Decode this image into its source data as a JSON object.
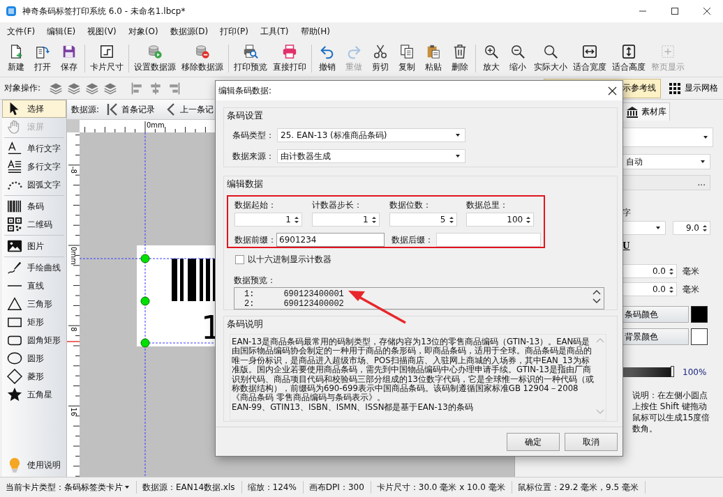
{
  "window": {
    "title": "神奇条码标签打印系统 6.0 - 未命名1.lbcp*"
  },
  "menu": [
    "文件(F)",
    "编辑(E)",
    "视图(V)",
    "对象(O)",
    "数据源(D)",
    "打印(P)",
    "工具(T)",
    "帮助(H)"
  ],
  "toolbar_groups": [
    {
      "buttons": [
        {
          "kind": "new",
          "label": "新建",
          "disabled": false
        },
        {
          "kind": "open",
          "label": "打开",
          "disabled": false
        },
        {
          "kind": "save",
          "label": "保存",
          "disabled": false
        }
      ]
    },
    {
      "buttons": [
        {
          "kind": "card_size",
          "label": "卡片尺寸",
          "disabled": false
        }
      ]
    },
    {
      "buttons": [
        {
          "kind": "set_source",
          "label": "设置数据源",
          "disabled": false
        },
        {
          "kind": "remove_source",
          "label": "移除数据源",
          "disabled": false
        }
      ]
    },
    {
      "buttons": [
        {
          "kind": "print_preview",
          "label": "打印预览",
          "disabled": false
        },
        {
          "kind": "print",
          "label": "直接打印",
          "disabled": false
        }
      ]
    },
    {
      "buttons": [
        {
          "kind": "undo",
          "label": "撤销",
          "disabled": false
        },
        {
          "kind": "redo",
          "label": "重做",
          "disabled": true
        },
        {
          "kind": "cut",
          "label": "剪切",
          "disabled": false
        },
        {
          "kind": "copy",
          "label": "复制",
          "disabled": false
        },
        {
          "kind": "paste",
          "label": "粘贴",
          "disabled": false
        },
        {
          "kind": "delete",
          "label": "删除",
          "disabled": false
        }
      ]
    },
    {
      "buttons": [
        {
          "kind": "zoom_in",
          "label": "放大",
          "disabled": false
        },
        {
          "kind": "zoom_out",
          "label": "缩小",
          "disabled": false
        },
        {
          "kind": "actual_size",
          "label": "实际大小",
          "disabled": false
        },
        {
          "kind": "fit_width",
          "label": "适合宽度",
          "disabled": false
        },
        {
          "kind": "fit_height",
          "label": "适合高度",
          "disabled": false
        },
        {
          "kind": "fit_page",
          "label": "整页显示",
          "disabled": true
        }
      ]
    }
  ],
  "object_bar": {
    "label": "对象操作:",
    "reference_lines": {
      "label": "示参考线",
      "on": true
    },
    "grid": {
      "label": "显示网格",
      "on": false
    }
  },
  "tool_groups": [
    {
      "tools": [
        {
          "kind": "select",
          "label": "选择",
          "selected": true,
          "disabled": false
        },
        {
          "kind": "pan",
          "label": "滚屏",
          "selected": false,
          "disabled": true
        }
      ]
    },
    {
      "tools": [
        {
          "kind": "text_line",
          "label": "单行文字",
          "selected": false,
          "disabled": false
        },
        {
          "kind": "text_multi",
          "label": "多行文字",
          "selected": false,
          "disabled": false
        },
        {
          "kind": "text_arc",
          "label": "圆弧文字",
          "selected": false,
          "disabled": false
        }
      ]
    },
    {
      "tools": [
        {
          "kind": "barcode",
          "label": "条码",
          "selected": false,
          "disabled": false
        },
        {
          "kind": "qrcode",
          "label": "二维码",
          "selected": false,
          "disabled": false
        }
      ]
    },
    {
      "tools": [
        {
          "kind": "picture",
          "label": "图片",
          "selected": false,
          "disabled": false
        }
      ]
    },
    {
      "tools": [
        {
          "kind": "pen",
          "label": "手绘曲线",
          "selected": false,
          "disabled": false
        },
        {
          "kind": "line",
          "label": "直线",
          "selected": false,
          "disabled": false
        },
        {
          "kind": "triangle",
          "label": "三角形",
          "selected": false,
          "disabled": false
        },
        {
          "kind": "rectangle",
          "label": "矩形",
          "selected": false,
          "disabled": false
        },
        {
          "kind": "rounded_rectangle",
          "label": "圆角矩形",
          "selected": false,
          "disabled": false
        },
        {
          "kind": "ellipse",
          "label": "圆形",
          "selected": false,
          "disabled": false
        },
        {
          "kind": "diamond",
          "label": "菱形",
          "selected": false,
          "disabled": false
        },
        {
          "kind": "star",
          "label": "五角星",
          "selected": false,
          "disabled": false
        }
      ]
    }
  ],
  "help": {
    "label": "使用说明"
  },
  "record_nav": {
    "label": "数据源:",
    "buttons": [
      {
        "kind": "first",
        "label": "首条记录"
      },
      {
        "kind": "previous",
        "label": "上一条记"
      }
    ]
  },
  "canvas": {
    "top_ruler": [
      "0mm"
    ],
    "left_ruler": [
      "-8",
      "0mm",
      "8",
      "16"
    ],
    "label_digit": "1"
  },
  "dialog": {
    "title": "编辑条码数据:",
    "barcode_settings": {
      "title": "条码设置",
      "fields": [
        {
          "label": "条码类型：",
          "value": "25. EAN-13 (标准商品条码)"
        },
        {
          "label": "数据来源：",
          "value": "由计数器生成"
        }
      ]
    },
    "edit_data": {
      "title": "编辑数据",
      "counters": [
        {
          "label": "数据起始：",
          "value": "1"
        },
        {
          "label": "计数器步长：",
          "value": "1"
        },
        {
          "label": "数据位数：",
          "value": "5"
        },
        {
          "label": "数据总里：",
          "value": "100"
        }
      ],
      "prefix": {
        "label": "数据前缀：",
        "value": "6901234"
      },
      "suffix": {
        "label": "数据后缀："
      },
      "hex": {
        "label": "以十六进制显示计数器",
        "checked": false
      },
      "preview": {
        "label": "数据预览：",
        "rows": [
          {
            "index": "1:",
            "value": "690123400001"
          },
          {
            "index": "2:",
            "value": "690123400002"
          }
        ]
      }
    },
    "description": {
      "title": "条码说明",
      "paragraphs": [
        "EAN-13是商品条码最常用的码制类型，存储内容为13位的零售商品编码（GTIN-13）。EAN码是由国际物品编码协会制定的一种用于商品的条形码，即商品条码，适用于全球。商品条码是商品的唯一身份标识，是商品进入超级市场、POS扫描商店、入驻网上商城的入场券，其中EAN_13为标准版。国内企业若要使用商品条码，需先到中国物品编码中心办理申请手续。GTIN-13是指由厂商识别代码、商品项目代码和校验码三部分组成的13位数字代码，它是全球惟一标识的一种代码（或称数据结构），前缀码为690-699表示中国商品条码。该码制遵循国家标准GB 12904－2008《商品条码 零售商品编码与条码表示》。",
        "EAN-99、GTIN13、ISBN、ISMN、ISSN都是基于EAN-13的条码"
      ]
    },
    "buttons": [
      "确定",
      "取消"
    ]
  },
  "right_panel": {
    "tab": "素材库",
    "auto_select": "自动",
    "more": "...",
    "font_heading": "字",
    "font_size": "9.0",
    "underline": "U",
    "offsets": [
      {
        "value": "0.0",
        "unit": "毫米"
      },
      {
        "value": "0.0",
        "unit": "毫米"
      }
    ],
    "colors": [
      {
        "label": "条码颜色",
        "color": "#000000"
      },
      {
        "label": "背景颜色",
        "color": "#ffffff"
      }
    ],
    "opacity": {
      "level": 1,
      "reading": "100%"
    },
    "note": "说明：在左侧小圆点上按住 Shift 键拖动鼠标可以生成15度倍数角。"
  },
  "status_bar": [
    {
      "kind": "dropdown",
      "label": "当前卡片类型：条码标签类卡片"
    },
    {
      "kind": "text",
      "label": "数据源：EAN14数据.xls"
    },
    {
      "kind": "text",
      "label": "缩放：124%"
    },
    {
      "kind": "text",
      "label": "画布DPI：300"
    },
    {
      "kind": "text",
      "label": "卡片尺寸：30.0 毫米 x 10.0 毫米"
    },
    {
      "kind": "text",
      "label": "鼠标位置：29.2 毫米，9.5 毫米"
    }
  ]
}
